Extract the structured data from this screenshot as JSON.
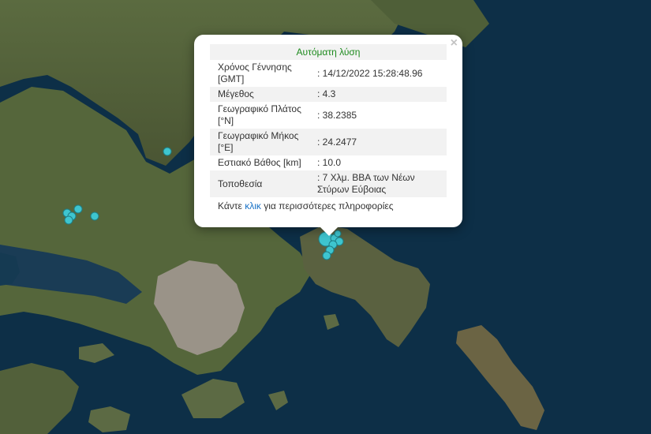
{
  "popup": {
    "title": "Αυτόματη λύση",
    "close_symbol": "×",
    "rows": [
      {
        "label": "Χρόνος Γέννησης [GMT]",
        "value": ": 14/12/2022 15:28:48.96"
      },
      {
        "label": "Μέγεθος",
        "value": ": 4.3"
      },
      {
        "label": "Γεωγραφικό Πλάτος [°N]",
        "value": ": 38.2385"
      },
      {
        "label": "Γεωγραφικό Μήκος [°E]",
        "value": ": 24.2477"
      },
      {
        "label": "Εστιακό Βάθος [km]",
        "value": ": 10.0"
      },
      {
        "label": "Τοποθεσία",
        "value": ": 7 Χλμ. ΒΒΑ των Νέων Στύρων Εύβοιας"
      }
    ],
    "more_prefix": "Κάντε ",
    "more_link": "κλικ",
    "more_suffix": " για περισσότερες πληροφορίες"
  },
  "colors": {
    "sea": "#0d2f47",
    "land": "#4a5a35",
    "urban": "#9a9388",
    "marker": "#3ec5cf",
    "title_green": "#1d8a1d",
    "link_blue": "#1a73c7"
  },
  "markers": [
    {
      "name": "marker-north",
      "size": "small"
    },
    {
      "name": "marker-west-1",
      "size": "small"
    },
    {
      "name": "marker-west-2",
      "size": "small"
    },
    {
      "name": "marker-west-3",
      "size": "small"
    },
    {
      "name": "marker-west-4",
      "size": "small"
    },
    {
      "name": "marker-west-5",
      "size": "small"
    },
    {
      "name": "marker-main-event",
      "size": "large"
    },
    {
      "name": "marker-cluster-1",
      "size": "small"
    },
    {
      "name": "marker-cluster-2",
      "size": "small"
    },
    {
      "name": "marker-cluster-3",
      "size": "small"
    },
    {
      "name": "marker-cluster-4",
      "size": "small"
    },
    {
      "name": "marker-cluster-5",
      "size": "small"
    },
    {
      "name": "marker-cluster-6",
      "size": "small"
    }
  ]
}
